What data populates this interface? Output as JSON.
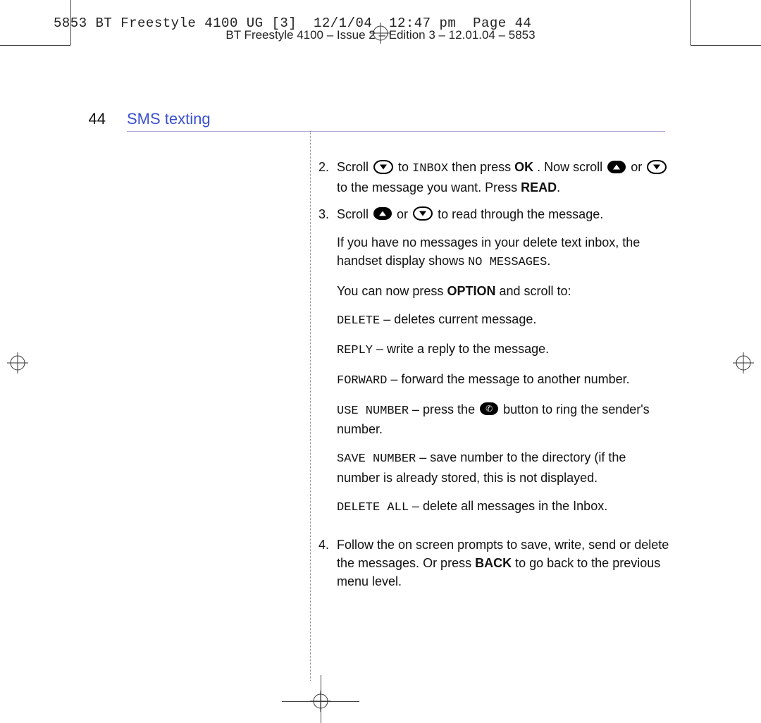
{
  "slug_line": "5853 BT Freestyle 4100 UG [3]  12/1/04  12:47 pm  Page 44",
  "running_head": "BT Freestyle 4100 – Issue 2 – Edition 3 – 12.01.04 – 5853",
  "page_number": "44",
  "section_title": "SMS texting",
  "lcd": {
    "inbox": "INBOX",
    "no_messages": "NO MESSAGES",
    "delete": "DELETE",
    "reply": "REPLY",
    "forward": "FORWARD",
    "use_number": "USE NUMBER",
    "save_number": "SAVE NUMBER",
    "delete_all": "DELETE ALL"
  },
  "steps": {
    "s2": {
      "num": "2.",
      "pre_inbox": "Scroll ",
      "post_inbox_a": " to ",
      "post_inbox_b": " then press ",
      "ok": "OK",
      "post_ok": ". Now scroll ",
      "or": " or ",
      "tail": " to the message you want. Press ",
      "read": "READ",
      "dot": "."
    },
    "s3": {
      "num": "3.",
      "pre": "Scroll ",
      "or": " or ",
      "tail": " to read through the message."
    },
    "no_msg": {
      "a": "If you have no messages in your delete text inbox, the handset display shows ",
      "dot": "."
    },
    "option_line": {
      "a": "You can now press ",
      "option": "OPTION",
      "b": " and scroll to:"
    },
    "delete_line": " – deletes current message.",
    "reply_line": " – write a reply to the message.",
    "forward_line": " – forward the message to another number.",
    "use_number_line_a": " – press the ",
    "use_number_line_b": " button to ring the sender's number.",
    "save_number_line": " – save number to the directory (if the number is already stored, this is not displayed.",
    "delete_all_line": " – delete all messages in the Inbox.",
    "s4": {
      "num": "4.",
      "a": "Follow the on screen prompts to save, write, send or delete the messages. Or press ",
      "back": "BACK",
      "b": " to go back to the previous menu level."
    }
  }
}
